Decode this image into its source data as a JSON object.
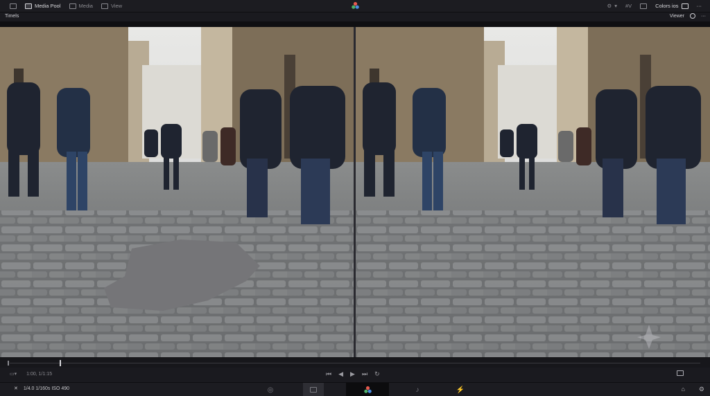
{
  "topbar": {
    "media_pool": "Media Pool",
    "media": "Media",
    "view": "View",
    "right_item_1": "#V",
    "colors": "Colors ios",
    "more": "···"
  },
  "subbar": {
    "left_label": "Timels",
    "right_label": "Viewer",
    "more": "···"
  },
  "transport": {
    "timecode": "1:00, 1/1:15",
    "prev": "⏮",
    "back": "◀",
    "play": "▶",
    "next": "⏭",
    "loop": "↻"
  },
  "bottombar": {
    "camera_info": "1/4.0  1/160s ISO 490"
  },
  "colors": {
    "accent": "#d8d8dc",
    "patch": "#757578"
  }
}
